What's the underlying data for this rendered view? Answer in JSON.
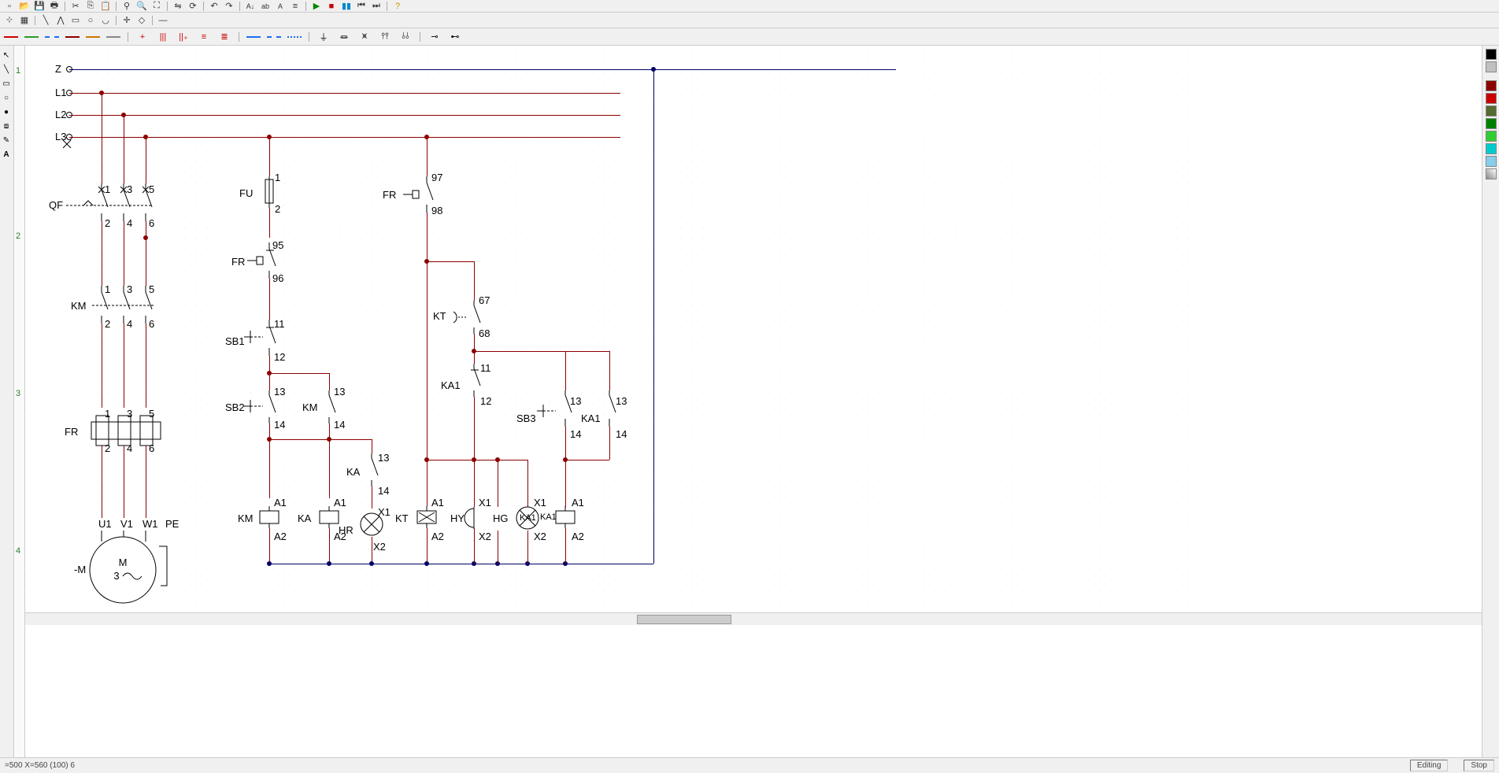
{
  "toolbars": {
    "row1_icons": [
      "new",
      "open",
      "save",
      "print",
      "|",
      "cut",
      "copy",
      "paste",
      "|",
      "find",
      "zoom",
      "zoom-fit",
      "|",
      "flip",
      "rotate",
      "|",
      "undo",
      "redo",
      "|",
      "text-a",
      "text-b",
      "text-c",
      "align",
      "|",
      "play",
      "stop",
      "pause",
      "step-back",
      "step-fwd",
      "|",
      "help"
    ],
    "row2_icons": [
      "snap",
      "grid",
      "|",
      "line",
      "polyline",
      "rect",
      "circle",
      "arc",
      "|",
      "crosshair",
      "center",
      "|",
      "minus"
    ],
    "row3_groups": {
      "line_colors": [
        "#cc0000",
        "#2a9d2a",
        "#1a6ef0",
        "#8b0000",
        "#cc7700",
        "#888888"
      ],
      "spacer": [
        "plus",
        "bars-3",
        "bars-2",
        "bars-left",
        "bars-right"
      ],
      "dash_styles": [
        "solid-blue",
        "dash-blue-1",
        "dash-blue-2"
      ],
      "coil_icons": [
        "coil-1",
        "coil-2",
        "coil-3",
        "coil-4",
        "coil-5"
      ],
      "end_icons": [
        "cap-o",
        "cap-o2"
      ]
    }
  },
  "ruler_marks": [
    "1",
    "2",
    "3",
    "4"
  ],
  "palette_colors": [
    "#000000",
    "#c0c0c0",
    "",
    "#8b0000",
    "#cc0000",
    "#556b2f",
    "#008000",
    "#32cd32",
    "#00cccc",
    "#87ceeb",
    ""
  ],
  "status": {
    "left": "=500  X=560 (100) 6",
    "right1": "Editing",
    "right2": "Stop"
  },
  "labels": {
    "Z": "Z",
    "L1": "L1",
    "L2": "L2",
    "L3": "L3",
    "QF": "QF",
    "QF_1": "1",
    "QF_3": "3",
    "QF_5": "5",
    "QF_2": "2",
    "QF_4": "4",
    "QF_6": "6",
    "KM_p": "KM",
    "KM_1": "1",
    "KM_3": "3",
    "KM_5": "5",
    "KM_2": "2",
    "KM_4": "4",
    "KM_6": "6",
    "FR_p": "FR",
    "FR_1": "1",
    "FR_3": "3",
    "FR_5": "5",
    "FR_2": "2",
    "FR_4": "4",
    "FR_6": "6",
    "U1": "U1",
    "V1": "V1",
    "W1": "W1",
    "PE": "PE",
    "M": "M",
    "Mminus": "-M",
    "M3": "3",
    "FU": "FU",
    "FU_1": "1",
    "FU_2": "2",
    "FR_c": "FR",
    "FR_95": "95",
    "FR_96": "96",
    "SB1": "SB1",
    "SB1_11": "11",
    "SB1_12": "12",
    "SB2": "SB2",
    "SB2_13": "13",
    "SB2_14": "14",
    "KM_a": "KM",
    "KM_13": "13",
    "KM_14": "14",
    "KA_a": "KA",
    "KA_13": "13",
    "KA_14": "14",
    "KM_c": "KM",
    "KA_c": "KA",
    "KT_c": "KT",
    "A1": "A1",
    "A2": "A2",
    "X1": "X1",
    "X2": "X2",
    "HR": "HR",
    "FR_c2": "FR",
    "FR_97": "97",
    "FR_98": "98",
    "KT": "KT",
    "KT_67": "67",
    "KT_68": "68",
    "KA1": "KA1",
    "KA1_11": "11",
    "KA1_12": "12",
    "SB3": "SB3",
    "SB3_13": "13",
    "SB3_14": "14",
    "KA1_a": "KA1",
    "KA1_13": "13",
    "KA1_14": "14",
    "HY": "HY",
    "HG": "HG",
    "KA1_c": "KA1"
  }
}
